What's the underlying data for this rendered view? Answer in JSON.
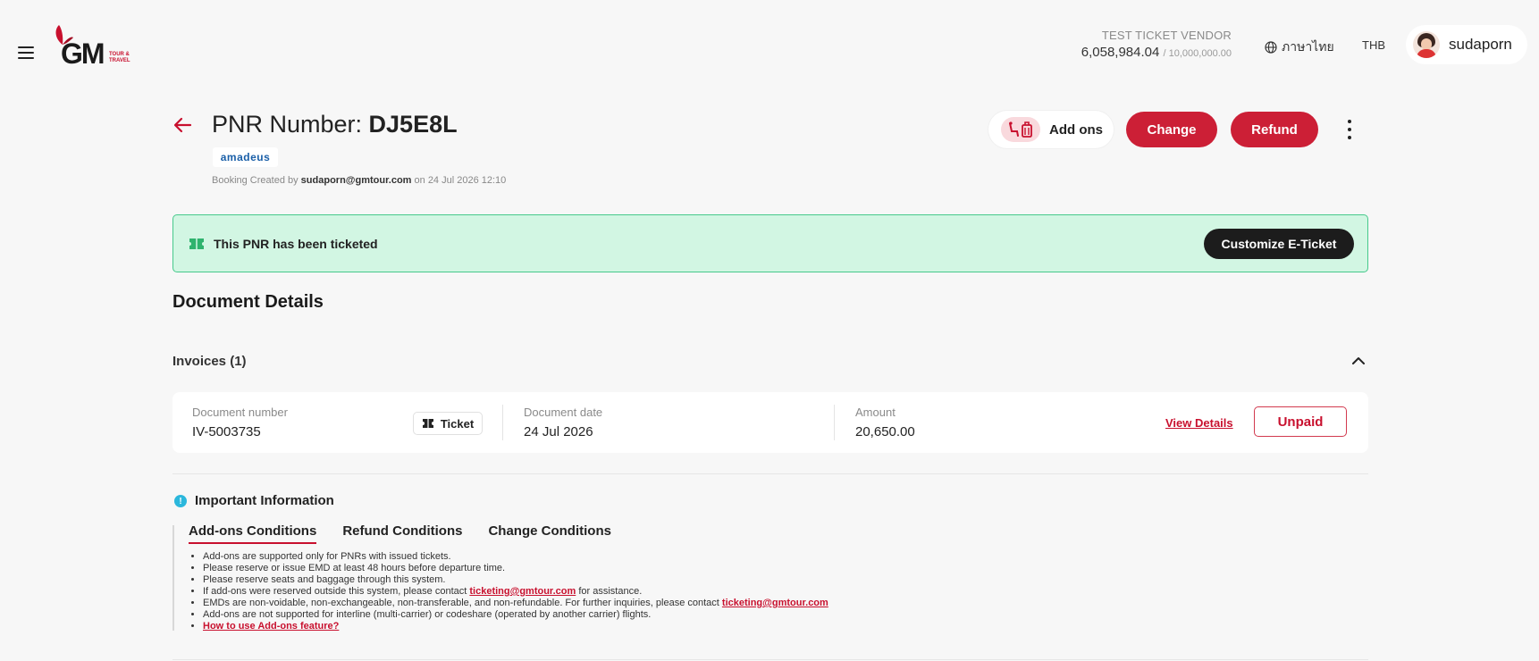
{
  "header": {
    "vendor_name": "TEST TICKET VENDOR",
    "credit_used": "6,058,984.04",
    "credit_limit": "/ 10,000,000.00",
    "language": "ภาษาไทย",
    "currency": "THB",
    "username": "sudaporn",
    "logo_text": "GM",
    "logo_sub1": "TOUR &",
    "logo_sub2": "TRAVEL"
  },
  "title": {
    "prefix": "PNR Number: ",
    "pnr": "DJ5E8L",
    "gds": "amadeus",
    "created_prefix": "Booking Created by ",
    "created_by": "sudaporn@gmtour.com",
    "created_on": " on 24 Jul 2026 12:10"
  },
  "actions": {
    "addons": "Add ons",
    "change": "Change",
    "refund": "Refund"
  },
  "banner": {
    "text": "This PNR has been ticketed",
    "button": "Customize E-Ticket"
  },
  "documents": {
    "title": "Document Details",
    "invoices_header": "Invoices (1)",
    "invoice": {
      "number_label": "Document number",
      "number": "IV-5003735",
      "type": "Ticket",
      "date_label": "Document date",
      "date": "24 Jul 2026",
      "amount_label": "Amount",
      "amount": "20,650.00",
      "view_details": "View Details",
      "status": "Unpaid"
    }
  },
  "important": {
    "title": "Important Information",
    "tabs": [
      "Add-ons Conditions",
      "Refund Conditions",
      "Change Conditions"
    ],
    "conditions": [
      "Add-ons are supported only for PNRs with issued tickets.",
      "Please reserve or issue EMD at least 48 hours before departure time.",
      "Please reserve seats and baggage through this system."
    ],
    "cond4_pre": "If add-ons were reserved outside this system, please contact ",
    "cond4_link": "ticketing@gmtour.com",
    "cond4_post": " for assistance.",
    "cond5_pre": "EMDs are non-voidable, non-exchangeable, non-transferable, and non-refundable. For further inquiries, please contact ",
    "cond5_link": "ticketing@gmtour.com",
    "cond6": "Add-ons are not supported for interline (multi-carrier) or codeshare (operated by another carrier) flights.",
    "howto_link": "How to use Add-ons feature?"
  }
}
